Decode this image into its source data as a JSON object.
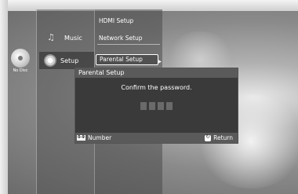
{
  "disc": {
    "label": "No Disc"
  },
  "main_menu": {
    "items": [
      {
        "label": "Music",
        "icon": "music-icon"
      },
      {
        "label": "Setup",
        "icon": "gear-icon",
        "active": true
      }
    ]
  },
  "submenu": {
    "items": [
      {
        "label": "HDMI Setup"
      },
      {
        "label": "Network Setup"
      },
      {
        "label": "Parental Setup",
        "active": true
      }
    ]
  },
  "dialog": {
    "title": "Parental Setup",
    "message": "Confirm the password.",
    "pin_slots": 4,
    "footer": {
      "number_key": "0-9",
      "number_label": "Number",
      "return_label": "Return"
    }
  }
}
